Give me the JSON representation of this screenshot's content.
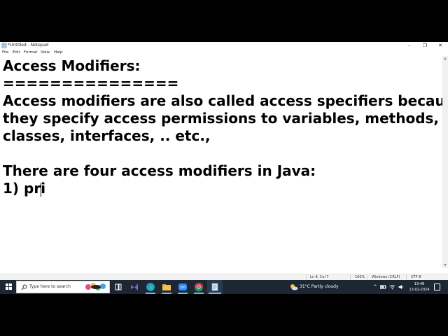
{
  "window": {
    "title": "*Untitled - Notepad",
    "minimize_glyph": "–",
    "maximize_glyph": "❐",
    "close_glyph": "✕"
  },
  "menu": {
    "items": [
      "File",
      "Edit",
      "Format",
      "View",
      "Help"
    ]
  },
  "editor": {
    "lines": [
      "Access Modifiers:",
      "===============",
      "Access modifiers are also called access specifiers because",
      "they specify access permissions to variables, methods,",
      "classes, interfaces, .. etc.,",
      "",
      "There are four access modifiers in Java:",
      "1) pri"
    ]
  },
  "status": {
    "position": "Ln 8, Col 7",
    "zoom": "160%",
    "line_ending": "Windows (CRLF)",
    "encoding": "UTF-8"
  },
  "taskbar": {
    "search_placeholder": "Type here to search",
    "weather": "31°C  Partly cloudy",
    "time": "19:48",
    "date": "13-02-2024",
    "colors": {
      "bar": "#1c2733",
      "active_indicator": "#7fb4ee"
    }
  }
}
